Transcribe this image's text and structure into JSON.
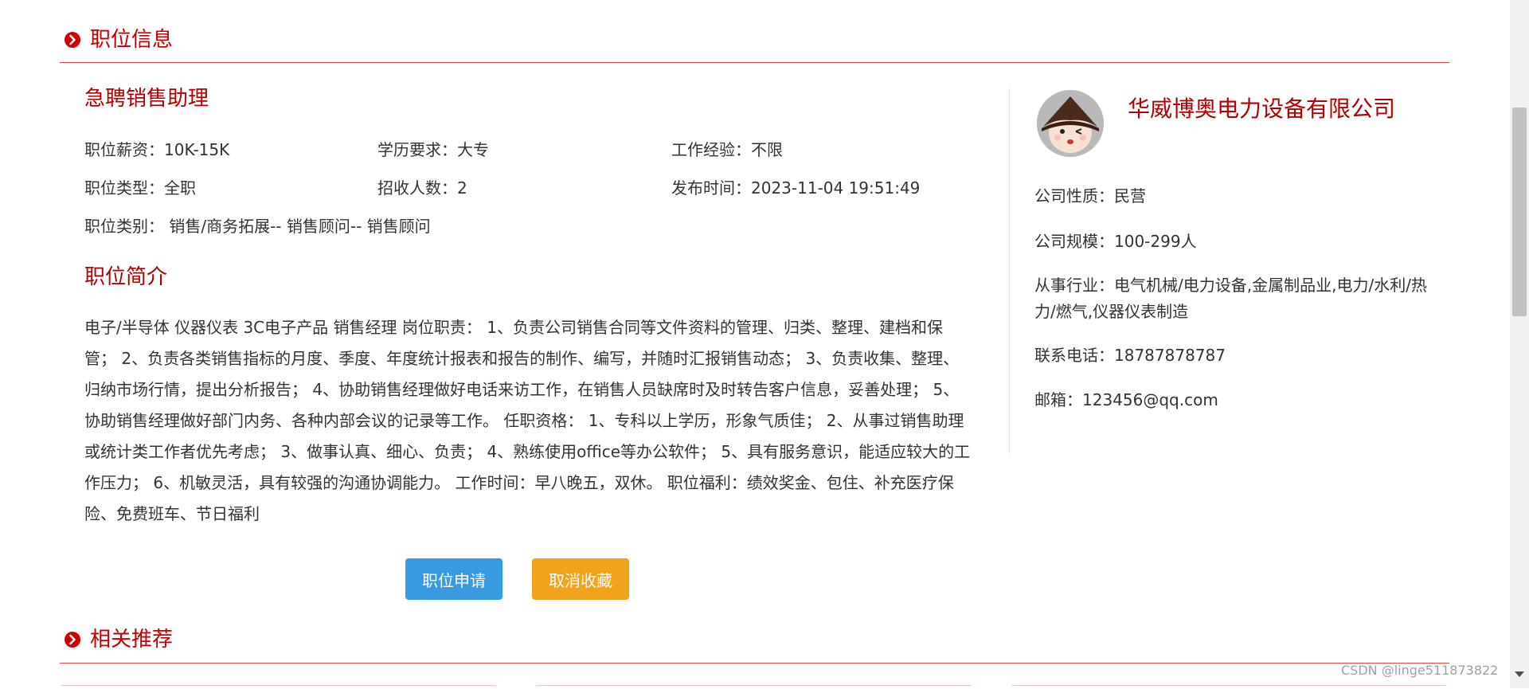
{
  "section_job": {
    "title": "职位信息"
  },
  "job": {
    "title": "急聘销售助理",
    "salary": "职位薪资：10K-15K",
    "education": "学历要求：大专",
    "experience": "工作经验：不限",
    "job_type": "职位类型：全职",
    "headcount": "招收人数：2",
    "publish_time": "发布时间：2023-11-04 19:51:49",
    "category": "职位类别： 销售/商务拓展-- 销售顾问-- 销售顾问",
    "intro_title": "职位简介",
    "description": "电子/半导体 仪器仪表 3C电子产品 销售经理 岗位职责： 1、负责公司销售合同等文件资料的管理、归类、整理、建档和保管； 2、负责各类销售指标的月度、季度、年度统计报表和报告的制作、编写，并随时汇报销售动态； 3、负责收集、整理、归纳市场行情，提出分析报告； 4、协助销售经理做好电话来访工作，在销售人员缺席时及时转告客户信息，妥善处理； 5、协助销售经理做好部门内务、各种内部会议的记录等工作。 任职资格： 1、专科以上学历，形象气质佳； 2、从事过销售助理或统计类工作者优先考虑； 3、做事认真、细心、负责； 4、熟练使用office等办公软件； 5、具有服务意识，能适应较大的工作压力； 6、机敏灵活，具有较强的沟通协调能力。 工作时间：早八晚五，双休。 职位福利：绩效奖金、包住、补充医疗保险、免费班车、节日福利"
  },
  "buttons": {
    "apply": "职位申请",
    "unfavorite": "取消收藏"
  },
  "company": {
    "name": "华威博奥电力设备有限公司",
    "nature": "公司性质：民营",
    "scale": "公司规模：100-299人",
    "industry": "从事行业：电气机械/电力设备,金属制品业,电力/水利/热力/燃气,仪器仪表制造",
    "phone": "联系电话：18787878787",
    "email": "邮箱：123456@qq.com"
  },
  "section_related": {
    "title": "相关推荐"
  },
  "watermark": "CSDN @linge511873822",
  "colors": {
    "accent_red": "#c40000",
    "apply_blue": "#3a9ae0",
    "unfav_orange": "#f2a31d"
  },
  "icons": {
    "section": "chevron-circle-right-icon"
  }
}
